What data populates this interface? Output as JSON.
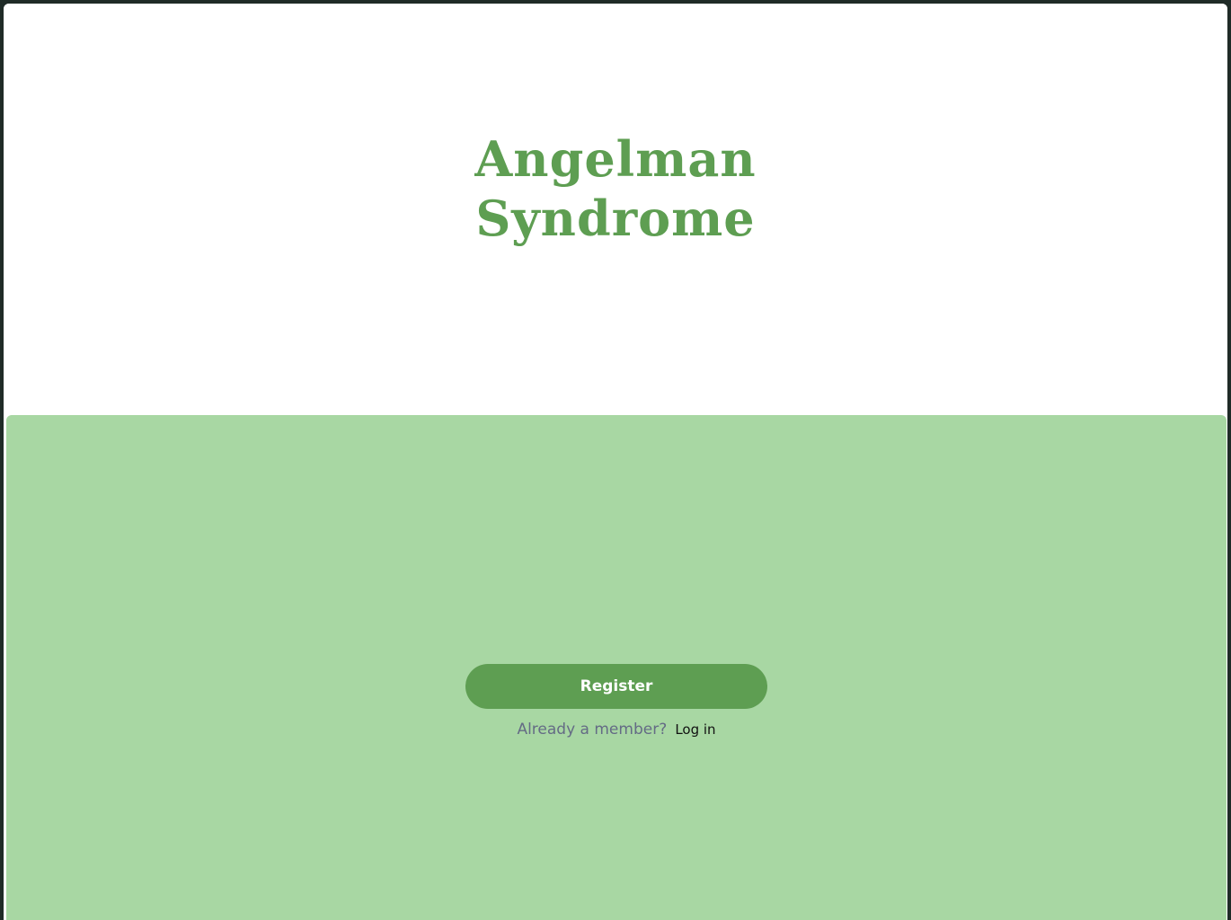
{
  "brand": {
    "title_line1": "Angelman",
    "title_line2": "Syndrome"
  },
  "auth": {
    "register_label": "Register",
    "member_prompt": "Already a member?",
    "login_label": "Log in"
  },
  "colors": {
    "brand_green": "#5e9e52",
    "panel_green": "#a8d7a3",
    "prompt_text": "#646b85",
    "window_border": "#1f2b27"
  }
}
